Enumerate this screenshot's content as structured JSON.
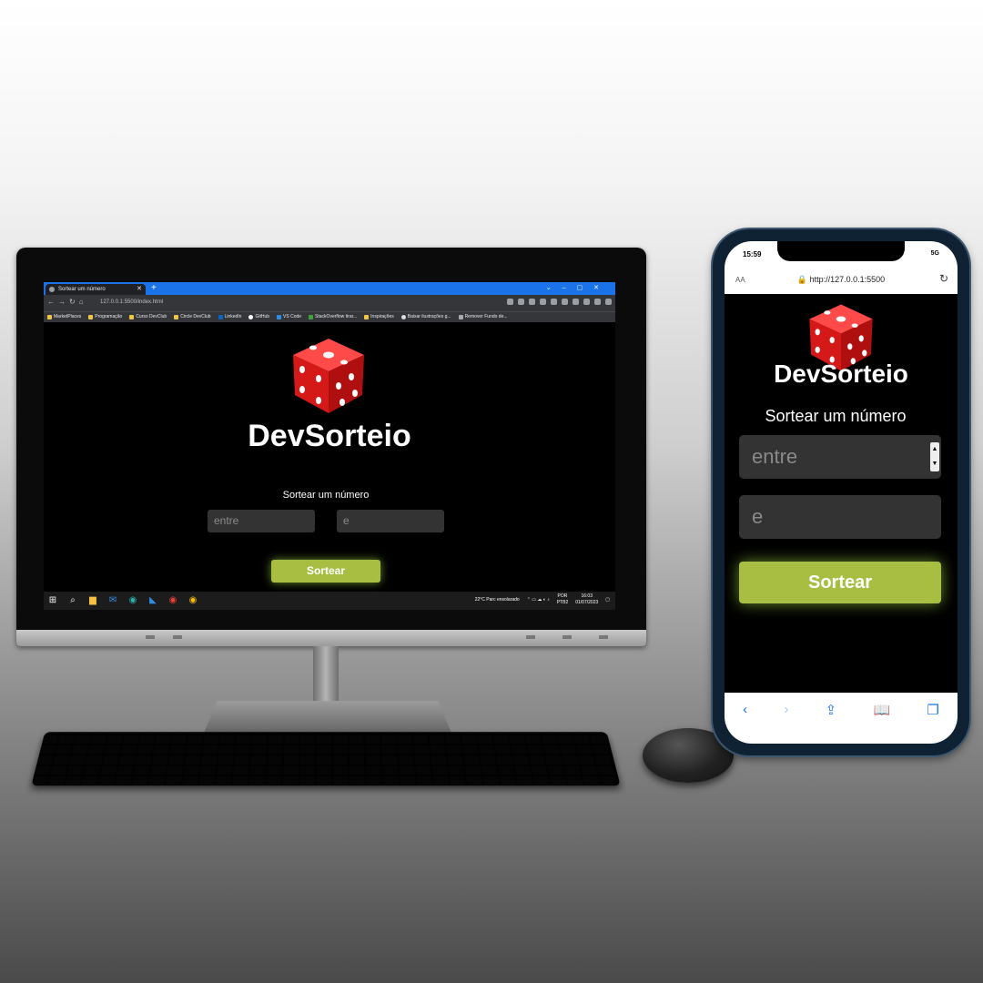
{
  "colors": {
    "accent": "#a8be42",
    "dice": "#e02020",
    "browser_blue": "#1a73e8"
  },
  "desktop": {
    "tab_title": "Sortear um número",
    "url": "127.0.0.1:5500/index.html",
    "bookmarks": [
      "MarketPlaces",
      "Programação",
      "Curso DevClub",
      "Circle DevClub",
      "LinkedIn",
      "GitHub",
      "VS Code",
      "StackOverflow tirar...",
      "Inspirações",
      "Baixar ilustrações g...",
      "Remover Fundo de..."
    ],
    "logo": "DevSorteio",
    "subtitle": "Sortear um número",
    "input1_placeholder": "entre",
    "input2_placeholder": "e",
    "button": "Sortear",
    "weather": "22°C  Parc ensolarado",
    "lang": "POR",
    "lang2": "PTB2",
    "time": "16:03",
    "date": "01/07/2023"
  },
  "mobile": {
    "time": "15:59",
    "signal": "5G",
    "aa": "AA",
    "url": "http://127.0.0.1:5500",
    "logo": "DevSorteio",
    "subtitle": "Sortear um número",
    "input1_placeholder": "entre",
    "input2_placeholder": "e",
    "button": "Sortear"
  }
}
